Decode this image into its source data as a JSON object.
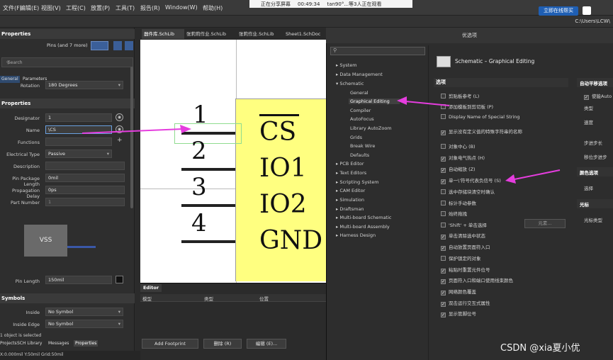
{
  "menu": {
    "items": [
      "文件(F)",
      "编辑(E)",
      "视图(V)",
      "工程(C)",
      "放置(P)",
      "工具(T)",
      "报告(R)",
      "Window(W)",
      "帮助(H)"
    ]
  },
  "share": {
    "status": "正在分享屏幕",
    "time": "00:49:34",
    "viewers": "tan90°...等3人正在观看"
  },
  "guide": {
    "label": "立即在线帮买"
  },
  "path_label": "C:\\Users\\LCW\\",
  "left": {
    "header": "Properties",
    "filter": "Pins (and 7 more)",
    "search_placeholder": "Search",
    "tabs": [
      "General",
      "Parameters"
    ],
    "rotation_label": "Rotation",
    "rotation_value": "180 Degrees",
    "section_properties": "Properties",
    "designator_label": "Designator",
    "designator_value": "1",
    "name_label": "Name",
    "name_value": "\\CS",
    "functions_label": "Functions",
    "electrical_label": "Electrical Type",
    "electrical_value": "Passive",
    "description_label": "Description",
    "pkg_len_label": "Pin Package Length",
    "pkg_len_value": "0mil",
    "prop_delay_label": "Propagation Delay",
    "prop_delay_value": "0ps",
    "part_num_label": "Part Number",
    "part_num_value": "1",
    "vss_label": "VSS",
    "pin_length_label": "Pin Length",
    "pin_length_value": "150mil",
    "section_symbols": "Symbols",
    "inside_label": "Inside",
    "inside_value": "No Symbol",
    "inside_edge_label": "Inside Edge",
    "inside_edge_value": "No Symbol",
    "selected_text": "1 object is selected",
    "bottom_tabs": [
      "Projects",
      "SCH Library",
      "Messages",
      "Properties"
    ],
    "status": "X:0.000mil Y:50mil   Grid:50mil"
  },
  "doctabs": [
    "器件库.SchLib",
    "张莉莉作业.SchLib",
    "张莉作业.SchLib",
    "Sheet1.SchDoc"
  ],
  "schematic": {
    "pin_numbers": [
      "1",
      "2",
      "3",
      "4"
    ],
    "pin_names": [
      "CS",
      "IO1",
      "IO2",
      "GND"
    ]
  },
  "editor": {
    "tab": "Editor",
    "columns": [
      "模型",
      "类型",
      "位置"
    ],
    "add_footprint": "Add Footprint",
    "delete": "删除 (R)",
    "edit": "编辑 (E)..."
  },
  "dialog": {
    "title": "优选项",
    "search_placeholder": "",
    "heading": "Schematic – Graphical Editing",
    "tree": [
      "System",
      "Data Management",
      "Schematic",
      "General",
      "Graphical Editing",
      "Compiler",
      "AutoFocus",
      "Library AutoZoom",
      "Grids",
      "Break Wire",
      "Defaults",
      "PCB Editor",
      "Text Editors",
      "Scripting System",
      "CAM Editor",
      "Simulation",
      "Draftsman",
      "Multi-board Schematic",
      "Multi-board Assembly",
      "Harness Design"
    ],
    "options_heading": "选项",
    "options": [
      {
        "label": "剪贴板参考 (L)",
        "checked": false
      },
      {
        "label": "添加模板到剪切板 (P)",
        "checked": false
      },
      {
        "label": "Display Name of Special String",
        "checked": false
      },
      {
        "label": "显示没有定义值的特殊字符串的名称",
        "checked": true
      },
      {
        "label": "对象中心 (B)",
        "checked": false
      },
      {
        "label": "对象电气热点 (H)",
        "checked": true
      },
      {
        "label": "自动缩放 (Z)",
        "checked": true
      },
      {
        "label": "单一\\'符号代表负信号 (S)",
        "checked": true
      },
      {
        "label": "选中存储块清空时确认",
        "checked": false
      },
      {
        "label": "标计手动参数",
        "checked": false
      },
      {
        "label": "始终拖拽",
        "checked": false
      },
      {
        "label": "'Shift' + 单击选择",
        "checked": false
      },
      {
        "label": "单击清除选中状态",
        "checked": true
      },
      {
        "label": "自动放置页面符入口",
        "checked": true
      },
      {
        "label": "保护锁定的对象",
        "checked": false
      },
      {
        "label": "粘贴时重置元件位号",
        "checked": true
      },
      {
        "label": "页面符入口和端口使用线束颜色",
        "checked": true
      },
      {
        "label": "网络颜色覆盖",
        "checked": true
      },
      {
        "label": "双击运行交互式属性",
        "checked": true
      },
      {
        "label": "显示管脚位号",
        "checked": true
      }
    ],
    "elements_btn": "元素...",
    "right": {
      "autopan_heading": "自动平移选项",
      "autopan_enable": "使能Auto",
      "type_label": "类型",
      "speed_label": "速度",
      "step_label": "步进步长",
      "shift_step_label": "移位步进步",
      "color_heading": "颜色选项",
      "select_label": "选择",
      "cursor_heading": "光标",
      "cursor_type": "光标类型"
    }
  },
  "watermark": "CSDN @xia夏小优",
  "colors": {
    "highlight_arrow": "#e53dde",
    "symbol_fill": "#ffff80",
    "accent": "#1f5fb4"
  }
}
